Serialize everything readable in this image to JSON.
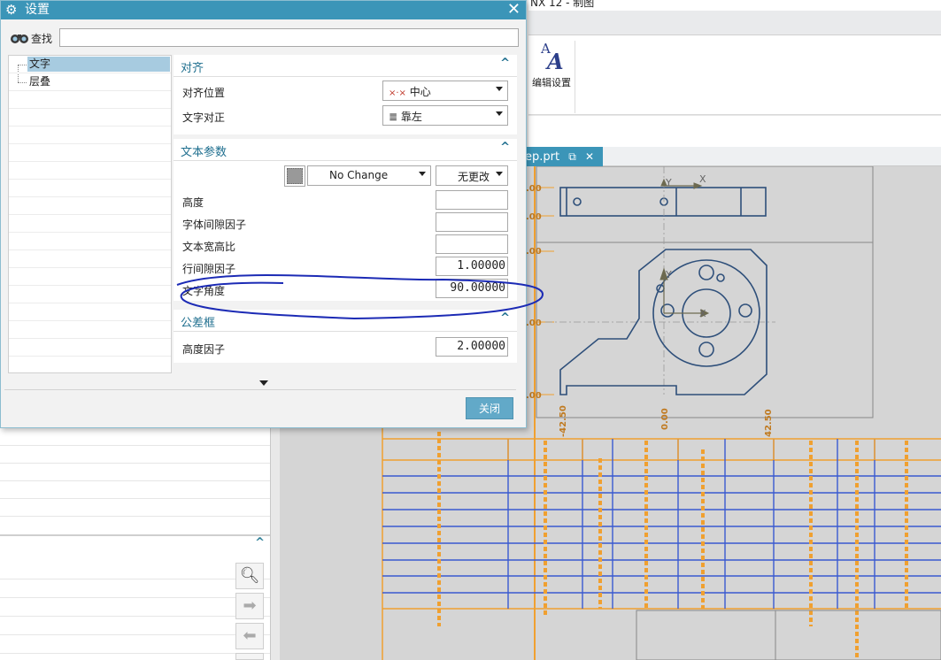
{
  "app": {
    "title_fragment": "NX 12 - 制图",
    "ribbon": {
      "edit_settings_label": "编辑设置"
    },
    "document_tab": {
      "label": "ep.prt"
    }
  },
  "drawing": {
    "x_label": "X",
    "y_label": "Y",
    "left_dim_labels": [
      ".00",
      ".00",
      ".00",
      ".00",
      ".00"
    ],
    "bottom_dim_labels": [
      "-42.50",
      "0.00",
      "42.50"
    ]
  },
  "dialog": {
    "title": "设置",
    "find_label": "查找",
    "find_value": "",
    "tree": [
      {
        "label": "文字",
        "selected": true
      },
      {
        "label": "层叠",
        "selected": false
      }
    ],
    "groups": {
      "alignment": {
        "title": "对齐",
        "position_label": "对齐位置",
        "position_value": "中心",
        "justify_label": "文字对正",
        "justify_value": "靠左"
      },
      "text_params": {
        "title": "文本参数",
        "color_value": "No Change",
        "change_value": "无更改",
        "height_label": "高度",
        "height_value": "",
        "char_space_label": "字体间隙因子",
        "char_space_value": "",
        "aspect_label": "文本宽高比",
        "aspect_value": "",
        "line_space_label": "行间隙因子",
        "line_space_value": "1.00000",
        "angle_label": "文字角度",
        "angle_value": "90.00000"
      },
      "tolerance_frame": {
        "title": "公差框",
        "height_factor_label": "高度因子",
        "height_factor_value": "2.00000"
      }
    },
    "close_label": "关闭"
  },
  "colors": {
    "accent": "#3b95b8",
    "group_title": "#1f6f8f",
    "annotation": "#1c2bb5",
    "drawing_line": "#2e4f7a",
    "table_orange": "#f0a030",
    "table_blue": "#3a5ad0"
  }
}
